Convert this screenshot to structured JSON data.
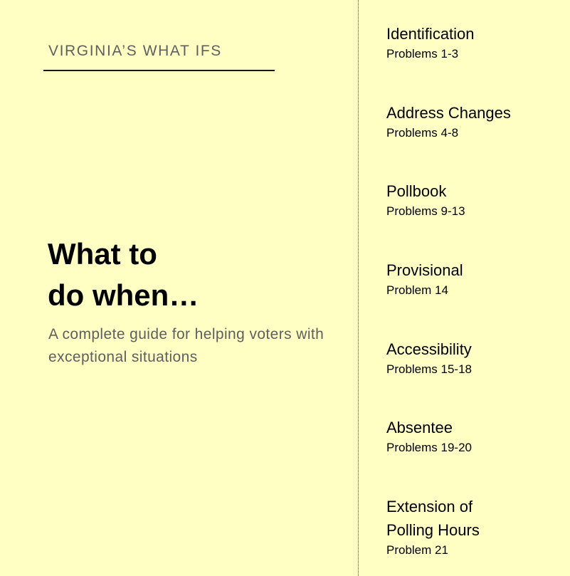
{
  "header": {
    "series_title": "VIRGINIA’S WHAT IFS"
  },
  "hero": {
    "heading": "What to\ndo when…",
    "subtitle": "A complete guide for helping voters with exceptional situations"
  },
  "toc": {
    "items": [
      {
        "name": "Identification",
        "range": "Problems 1-3"
      },
      {
        "name": "Address Changes",
        "range": "Problems 4-8"
      },
      {
        "name": "Pollbook",
        "range": "Problems 9-13"
      },
      {
        "name": "Provisional",
        "range": "Problem 14"
      },
      {
        "name": "Accessibility",
        "range": "Problems 15-18"
      },
      {
        "name": "Absentee",
        "range": "Problems 19-20"
      },
      {
        "name": "Extension of\nPolling Hours",
        "range": "Problem 21"
      }
    ]
  },
  "colors": {
    "page_background": "#ffffc4",
    "muted_text": "#5f5f5f",
    "heading_text": "#000000"
  }
}
